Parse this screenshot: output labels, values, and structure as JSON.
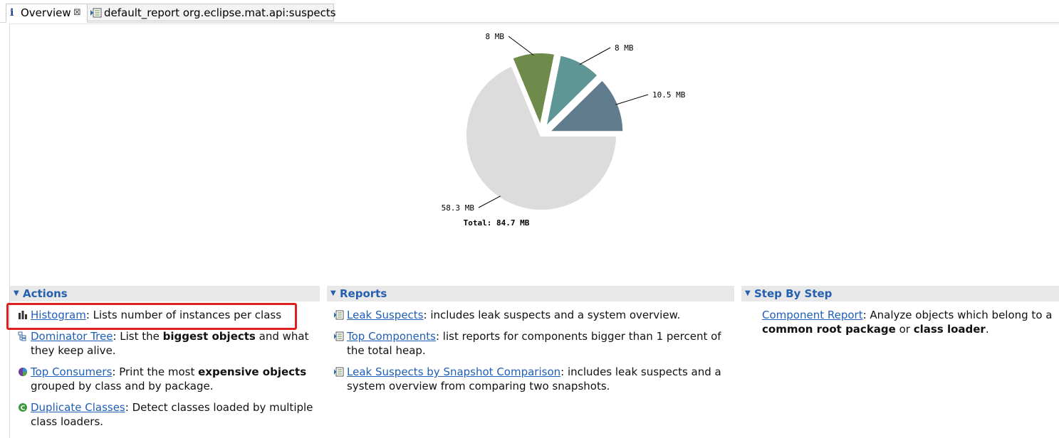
{
  "tabs": [
    {
      "label": "Overview",
      "icon": "info-icon",
      "active": true
    },
    {
      "label": "default_report  org.eclipse.mat.api:suspects",
      "icon": "report-icon",
      "active": false
    }
  ],
  "chart_data": {
    "type": "pie",
    "values": [
      58.3,
      8,
      8,
      10.5
    ],
    "labels": [
      "58.3 MB",
      "8 MB",
      "8 MB",
      "10.5 MB"
    ],
    "colors": [
      "#dcdcdc",
      "#6e8b4c",
      "#5e9696",
      "#5f7b8c"
    ],
    "total_label": "Total: 84.7 MB"
  },
  "actions": {
    "title": "Actions",
    "items": [
      {
        "link": "Histogram",
        "rest": ": Lists number of instances per class"
      },
      {
        "link": "Dominator Tree",
        "pre": ": List the ",
        "bold": "biggest objects",
        "post": " and what",
        "line2": "they keep alive."
      },
      {
        "link": "Top Consumers",
        "pre": ": Print the most ",
        "bold": "expensive objects",
        "line2": "grouped by class and by package."
      },
      {
        "link": "Duplicate Classes",
        "pre": ": Detect classes loaded by multiple",
        "line2": "class loaders."
      }
    ]
  },
  "reports": {
    "title": "Reports",
    "items": [
      {
        "link": "Leak Suspects",
        "pre": ": includes leak suspects and a system overview."
      },
      {
        "link": "Top Components",
        "pre": ": list reports for components bigger than 1 percent of",
        "line2": "the total heap."
      },
      {
        "link": "Leak Suspects by Snapshot Comparison",
        "pre": ": includes leak suspects and a",
        "line2": "system overview from comparing two snapshots."
      }
    ]
  },
  "stepbystep": {
    "title": "Step By Step",
    "items": [
      {
        "link": "Component Report",
        "pre": ": Analyze objects which belong to a",
        "bold1": "common root package",
        "mid": " or ",
        "bold2": "class loader",
        "post": "."
      }
    ]
  }
}
